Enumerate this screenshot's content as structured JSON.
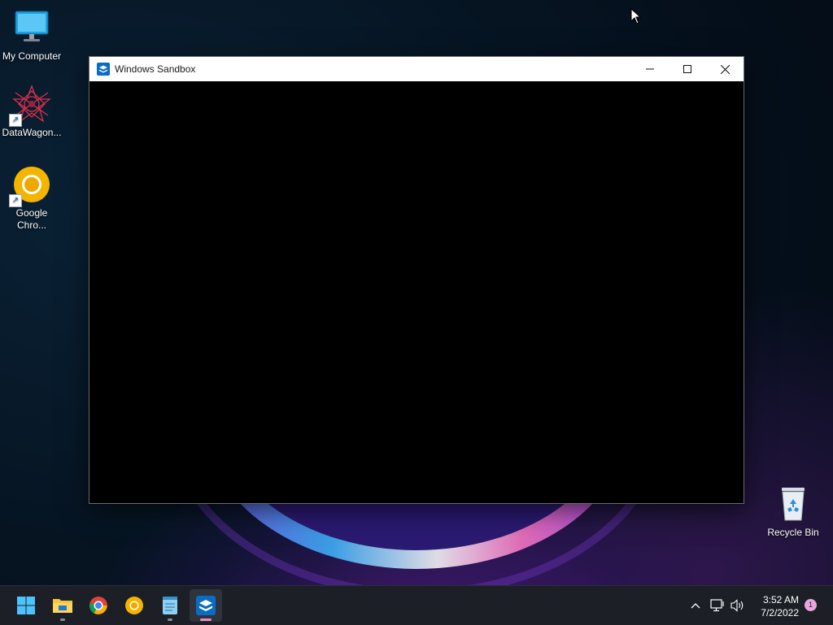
{
  "desktop": {
    "icons": [
      {
        "label": "My Computer",
        "icon": "monitor-icon"
      },
      {
        "label": "DataWagon...",
        "icon": "datawagon-icon"
      },
      {
        "label": "Google Chro...",
        "icon": "chrome-canary-icon"
      },
      {
        "label": "Recycle Bin",
        "icon": "recycle-bin-icon"
      }
    ]
  },
  "window": {
    "title": "Windows Sandbox",
    "icon": "sandbox-icon",
    "buttons": {
      "minimize": "minimize-icon",
      "maximize": "maximize-icon",
      "close": "close-icon"
    }
  },
  "taskbar": {
    "items": [
      {
        "name": "start",
        "icon": "windows-start-icon"
      },
      {
        "name": "file-explorer",
        "icon": "folder-icon",
        "running": true
      },
      {
        "name": "chrome",
        "icon": "chrome-icon"
      },
      {
        "name": "chrome-canary",
        "icon": "chrome-canary-icon"
      },
      {
        "name": "notepad",
        "icon": "notepad-icon",
        "running": true
      },
      {
        "name": "windows-sandbox",
        "icon": "sandbox-icon",
        "running": true,
        "active": true
      }
    ],
    "tray": {
      "icons": [
        "chevron-up-icon",
        "network-icon",
        "speaker-icon"
      ],
      "time": "3:52 AM",
      "date": "7/2/2022",
      "notification_count": "1"
    }
  },
  "colors": {
    "taskbar_bg": "#1c1f26",
    "accent": "#0078d4",
    "active_indicator": "#e48fc8"
  }
}
